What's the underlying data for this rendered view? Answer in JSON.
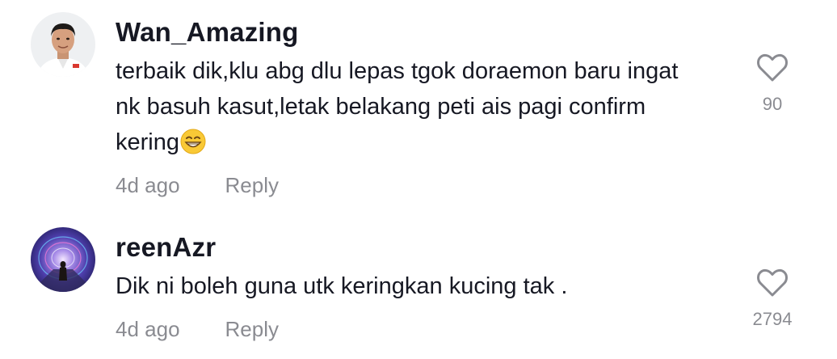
{
  "comments": [
    {
      "username": "Wan_Amazing",
      "text": "terbaik dik,klu abg dlu lepas tgok doraemon baru ingat nk basuh kasut,letak belakang peti ais pagi confirm kering",
      "emoji": "grinning-face-with-smiling-eyes",
      "time": "4d ago",
      "reply_label": "Reply",
      "likes": "90"
    },
    {
      "username": "reenAzr",
      "text": "Dik ni boleh guna utk keringkan kucing tak .",
      "time": "4d ago",
      "reply_label": "Reply",
      "likes": "2794"
    }
  ],
  "colors": {
    "text": "#161823",
    "muted": "#8a8b91",
    "background": "#ffffff"
  },
  "icons": {
    "like": "heart-outline-icon"
  }
}
